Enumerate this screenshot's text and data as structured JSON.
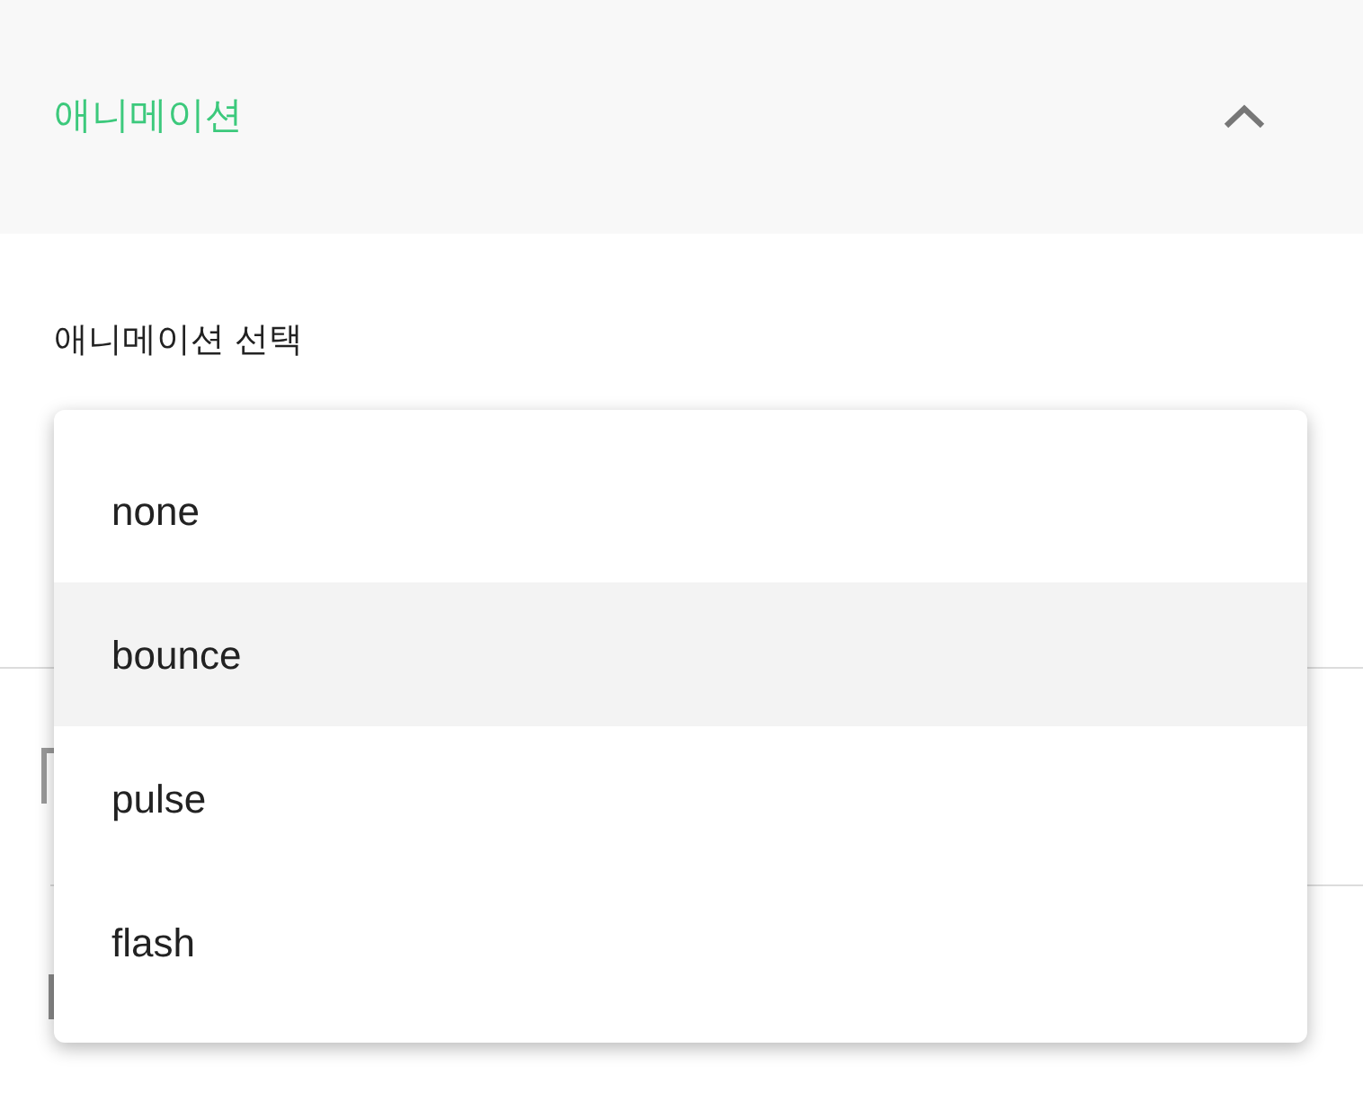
{
  "section": {
    "title": "애니메이션",
    "expanded": true
  },
  "field": {
    "label": "애니메이션 선택"
  },
  "dropdown": {
    "options": [
      {
        "label": "none",
        "selected": false
      },
      {
        "label": "bounce",
        "selected": true
      },
      {
        "label": "pulse",
        "selected": false
      },
      {
        "label": "flash",
        "selected": false
      }
    ]
  }
}
